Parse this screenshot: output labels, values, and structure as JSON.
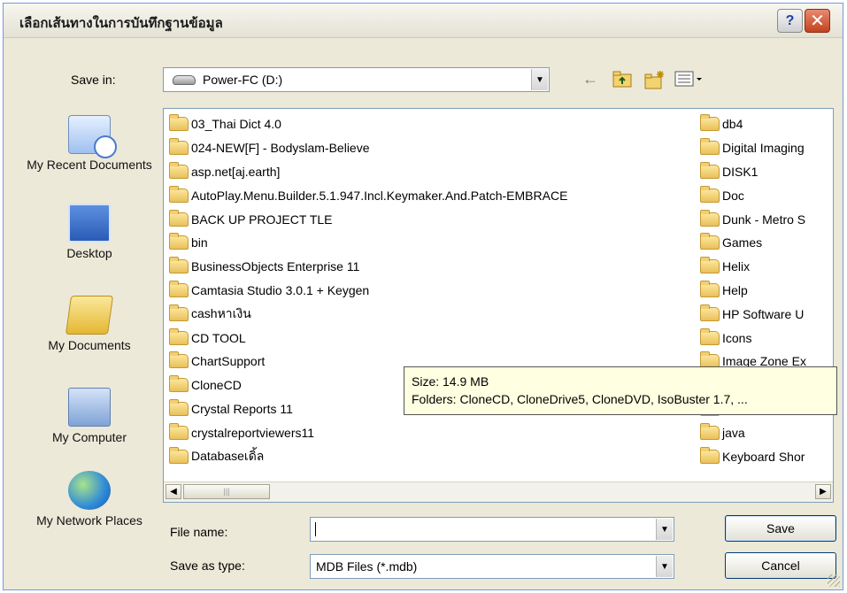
{
  "dialog": {
    "title": "เลือกเส้นทางในการบันทึกฐานข้อมูล",
    "help_glyph": "?",
    "close_glyph": "✕"
  },
  "save_in": {
    "label": "Save in:",
    "value": "Power-FC (D:)"
  },
  "toolbar": {
    "back_icon": "back-arrow-icon",
    "up_icon": "up-folder-icon",
    "new_folder_icon": "new-folder-icon",
    "views_icon": "views-menu-icon"
  },
  "places": [
    {
      "label": "My Recent Documents",
      "icon": "recent-documents-icon"
    },
    {
      "label": "Desktop",
      "icon": "desktop-icon"
    },
    {
      "label": "My Documents",
      "icon": "my-documents-icon"
    },
    {
      "label": "My Computer",
      "icon": "my-computer-icon"
    },
    {
      "label": "My Network Places",
      "icon": "network-places-icon"
    }
  ],
  "files_col1": [
    "03_Thai Dict 4.0",
    "024-NEW[F] - Bodyslam-Believe",
    "asp.net[aj.earth]",
    "AutoPlay.Menu.Builder.5.1.947.Incl.Keymaker.And.Patch-EMBRACE",
    "BACK UP PROJECT TLE",
    "bin",
    "BusinessObjects Enterprise 11",
    "Camtasia Studio 3.0.1 + Keygen",
    "cashหาเงิน",
    "CD TOOL",
    "ChartSupport",
    "CloneCD",
    "Crystal Reports 11",
    "crystalreportviewers11",
    "Databaseเดิ้ล"
  ],
  "files_col2": [
    "db4",
    "Digital Imaging",
    "DISK1",
    "Doc",
    "Dunk - Metro S",
    "Games",
    "Helix",
    "Help",
    "HP Software U",
    "Icons",
    "Image Zone Ex",
    "",
    "",
    "java",
    "Keyboard Shor"
  ],
  "tooltip": {
    "size": "Size: 14.9 MB",
    "folders": "Folders: CloneCD, CloneDrive5, CloneDVD, IsoBuster 1.7, ..."
  },
  "file_name": {
    "label": "File name:",
    "value": ""
  },
  "save_as_type": {
    "label": "Save as type:",
    "value": "MDB Files (*.mdb)"
  },
  "buttons": {
    "save": "Save",
    "cancel": "Cancel"
  }
}
